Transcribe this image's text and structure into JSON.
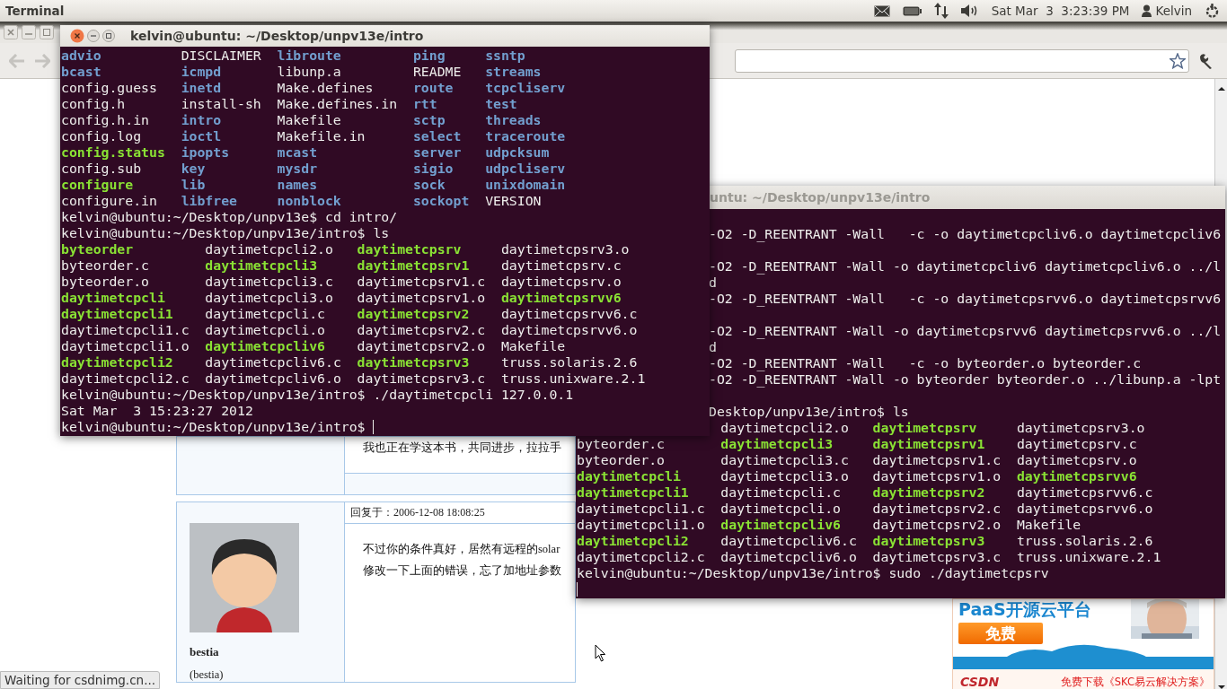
{
  "top_panel": {
    "app_name": "Terminal",
    "clock": "Sat Mar  3  3:23:39 PM",
    "user": "Kelvin"
  },
  "browser": {
    "status": "Waiting for csdnimg.cn...",
    "posts": [
      {
        "body": [
          "我也正在学这本书，共同进步，拉拉手"
        ]
      },
      {
        "reply_time": "回复于：2006-12-08 18:08:25",
        "user": "bestia",
        "user_alias": "(bestia)",
        "body": [
          "不过你的条件真好，居然有远程的solar",
          "修改一下上面的错误，忘了加地址参数"
        ]
      }
    ],
    "ad": {
      "headline": "PaaS开源云平台",
      "button": "免费",
      "logo": "CSDN",
      "footer": "免费下载《SKC易云解决方案》"
    }
  },
  "terminals": [
    {
      "title": "kelvin@ubuntu: ~/Desktop/unpv13e/intro",
      "active": true,
      "lines": [
        {
          "kind": "ls",
          "cells": [
            {
              "text": "advio",
              "kind": "dir"
            },
            {
              "text": "DISCLAIMER",
              "kind": "file"
            },
            {
              "text": "libroute",
              "kind": "dir"
            },
            {
              "text": "ping",
              "kind": "dir"
            },
            {
              "text": "ssntp",
              "kind": "dir"
            }
          ]
        },
        {
          "kind": "ls",
          "cells": [
            {
              "text": "bcast",
              "kind": "dir"
            },
            {
              "text": "icmpd",
              "kind": "dir"
            },
            {
              "text": "libunp.a",
              "kind": "file"
            },
            {
              "text": "README",
              "kind": "file"
            },
            {
              "text": "streams",
              "kind": "dir"
            }
          ]
        },
        {
          "kind": "ls",
          "cells": [
            {
              "text": "config.guess",
              "kind": "file"
            },
            {
              "text": "inetd",
              "kind": "dir"
            },
            {
              "text": "Make.defines",
              "kind": "file"
            },
            {
              "text": "route",
              "kind": "dir"
            },
            {
              "text": "tcpcliserv",
              "kind": "dir"
            }
          ]
        },
        {
          "kind": "ls",
          "cells": [
            {
              "text": "config.h",
              "kind": "file"
            },
            {
              "text": "install-sh",
              "kind": "file"
            },
            {
              "text": "Make.defines.in",
              "kind": "file"
            },
            {
              "text": "rtt",
              "kind": "dir"
            },
            {
              "text": "test",
              "kind": "dir"
            }
          ]
        },
        {
          "kind": "ls",
          "cells": [
            {
              "text": "config.h.in",
              "kind": "file"
            },
            {
              "text": "intro",
              "kind": "dir"
            },
            {
              "text": "Makefile",
              "kind": "file"
            },
            {
              "text": "sctp",
              "kind": "dir"
            },
            {
              "text": "threads",
              "kind": "dir"
            }
          ]
        },
        {
          "kind": "ls",
          "cells": [
            {
              "text": "config.log",
              "kind": "file"
            },
            {
              "text": "ioctl",
              "kind": "dir"
            },
            {
              "text": "Makefile.in",
              "kind": "file"
            },
            {
              "text": "select",
              "kind": "dir"
            },
            {
              "text": "traceroute",
              "kind": "dir"
            }
          ]
        },
        {
          "kind": "ls",
          "cells": [
            {
              "text": "config.status",
              "kind": "exec"
            },
            {
              "text": "ipopts",
              "kind": "dir"
            },
            {
              "text": "mcast",
              "kind": "dir"
            },
            {
              "text": "server",
              "kind": "dir"
            },
            {
              "text": "udpcksum",
              "kind": "dir"
            }
          ]
        },
        {
          "kind": "ls",
          "cells": [
            {
              "text": "config.sub",
              "kind": "file"
            },
            {
              "text": "key",
              "kind": "dir"
            },
            {
              "text": "mysdr",
              "kind": "dir"
            },
            {
              "text": "sigio",
              "kind": "dir"
            },
            {
              "text": "udpcliserv",
              "kind": "dir"
            }
          ]
        },
        {
          "kind": "ls",
          "cells": [
            {
              "text": "configure",
              "kind": "exec"
            },
            {
              "text": "lib",
              "kind": "dir"
            },
            {
              "text": "names",
              "kind": "dir"
            },
            {
              "text": "sock",
              "kind": "dir"
            },
            {
              "text": "unixdomain",
              "kind": "dir"
            }
          ]
        },
        {
          "kind": "ls",
          "cells": [
            {
              "text": "configure.in",
              "kind": "file"
            },
            {
              "text": "libfree",
              "kind": "dir"
            },
            {
              "text": "nonblock",
              "kind": "dir"
            },
            {
              "text": "sockopt",
              "kind": "dir"
            },
            {
              "text": "VERSION",
              "kind": "file"
            }
          ]
        },
        {
          "kind": "text",
          "text": "kelvin@ubuntu:~/Desktop/unpv13e$ cd intro/"
        },
        {
          "kind": "text",
          "text": "kelvin@ubuntu:~/Desktop/unpv13e/intro$ ls"
        },
        {
          "kind": "ls",
          "cells": [
            {
              "text": "byteorder",
              "kind": "exec"
            },
            {
              "text": "daytimetcpcli2.o",
              "kind": "file"
            },
            {
              "text": "daytimetcpsrv",
              "kind": "exec"
            },
            {
              "text": "daytimetcpsrv3.o",
              "kind": "file"
            }
          ]
        },
        {
          "kind": "ls",
          "cells": [
            {
              "text": "byteorder.c",
              "kind": "file"
            },
            {
              "text": "daytimetcpcli3",
              "kind": "exec"
            },
            {
              "text": "daytimetcpsrv1",
              "kind": "exec"
            },
            {
              "text": "daytimetcpsrv.c",
              "kind": "file"
            }
          ]
        },
        {
          "kind": "ls",
          "cells": [
            {
              "text": "byteorder.o",
              "kind": "file"
            },
            {
              "text": "daytimetcpcli3.c",
              "kind": "file"
            },
            {
              "text": "daytimetcpsrv1.c",
              "kind": "file"
            },
            {
              "text": "daytimetcpsrv.o",
              "kind": "file"
            }
          ]
        },
        {
          "kind": "ls",
          "cells": [
            {
              "text": "daytimetcpcli",
              "kind": "exec"
            },
            {
              "text": "daytimetcpcli3.o",
              "kind": "file"
            },
            {
              "text": "daytimetcpsrv1.o",
              "kind": "file"
            },
            {
              "text": "daytimetcpsrvv6",
              "kind": "exec"
            }
          ]
        },
        {
          "kind": "ls",
          "cells": [
            {
              "text": "daytimetcpcli1",
              "kind": "exec"
            },
            {
              "text": "daytimetcpcli.c",
              "kind": "file"
            },
            {
              "text": "daytimetcpsrv2",
              "kind": "exec"
            },
            {
              "text": "daytimetcpsrvv6.c",
              "kind": "file"
            }
          ]
        },
        {
          "kind": "ls",
          "cells": [
            {
              "text": "daytimetcpcli1.c",
              "kind": "file"
            },
            {
              "text": "daytimetcpcli.o",
              "kind": "file"
            },
            {
              "text": "daytimetcpsrv2.c",
              "kind": "file"
            },
            {
              "text": "daytimetcpsrvv6.o",
              "kind": "file"
            }
          ]
        },
        {
          "kind": "ls",
          "cells": [
            {
              "text": "daytimetcpcli1.o",
              "kind": "file"
            },
            {
              "text": "daytimetcpcliv6",
              "kind": "exec"
            },
            {
              "text": "daytimetcpsrv2.o",
              "kind": "file"
            },
            {
              "text": "Makefile",
              "kind": "file"
            }
          ]
        },
        {
          "kind": "ls",
          "cells": [
            {
              "text": "daytimetcpcli2",
              "kind": "exec"
            },
            {
              "text": "daytimetcpcliv6.c",
              "kind": "file"
            },
            {
              "text": "daytimetcpsrv3",
              "kind": "exec"
            },
            {
              "text": "truss.solaris.2.6",
              "kind": "file"
            }
          ]
        },
        {
          "kind": "ls",
          "cells": [
            {
              "text": "daytimetcpcli2.c",
              "kind": "file"
            },
            {
              "text": "daytimetcpcliv6.o",
              "kind": "file"
            },
            {
              "text": "daytimetcpsrv3.c",
              "kind": "file"
            },
            {
              "text": "truss.unixware.2.1",
              "kind": "file"
            }
          ]
        },
        {
          "kind": "text",
          "text": "kelvin@ubuntu:~/Desktop/unpv13e/intro$ ./daytimetcpcli 127.0.0.1"
        },
        {
          "kind": "text",
          "text": "Sat Mar  3 15:23:27 2012"
        },
        {
          "kind": "prompt",
          "text": "kelvin@ubuntu:~/Desktop/unpv13e/intro$"
        }
      ]
    },
    {
      "title": "untu: ~/Desktop/unpv13e/intro",
      "active": false,
      "upper_lines": [
        {
          "kind": "gap"
        },
        {
          "kind": "text",
          "text": "-O2 -D_REENTRANT -Wall   -c -o daytimetcpcliv6.o daytimetcpcliv6"
        },
        {
          "kind": "gap"
        },
        {
          "kind": "text",
          "text": "-O2 -D_REENTRANT -Wall -o daytimetcpcliv6 daytimetcpcliv6.o ../l"
        },
        {
          "kind": "text",
          "text": "d"
        },
        {
          "kind": "text",
          "text": "-O2 -D_REENTRANT -Wall   -c -o daytimetcpsrvv6.o daytimetcpsrvv6"
        },
        {
          "kind": "gap"
        },
        {
          "kind": "text",
          "text": "-O2 -D_REENTRANT -Wall -o daytimetcpsrvv6 daytimetcpsrvv6.o ../l"
        },
        {
          "kind": "text",
          "text": "d"
        },
        {
          "kind": "text",
          "text": "-O2 -D_REENTRANT -Wall   -c -o byteorder.o byteorder.c"
        },
        {
          "kind": "text",
          "text": "-O2 -D_REENTRANT -Wall -o byteorder byteorder.o ../libunp.a -lpt"
        },
        {
          "kind": "gap"
        },
        {
          "kind": "text",
          "text": "Desktop/unpv13e/intro$ ls"
        }
      ],
      "lines": [
        {
          "kind": "ls",
          "cells": [
            {
              "text": "daytimetcpcli2.o",
              "kind": "file"
            },
            {
              "text": "daytimetcpsrv",
              "kind": "exec"
            },
            {
              "text": "daytimetcpsrv3.o",
              "kind": "file"
            }
          ]
        },
        {
          "kind": "ls",
          "cells": [
            {
              "text": "byteorder.c",
              "kind": "file"
            },
            {
              "text": "daytimetcpcli3",
              "kind": "exec"
            },
            {
              "text": "daytimetcpsrv1",
              "kind": "exec"
            },
            {
              "text": "daytimetcpsrv.c",
              "kind": "file"
            }
          ]
        },
        {
          "kind": "ls",
          "cells": [
            {
              "text": "byteorder.o",
              "kind": "file"
            },
            {
              "text": "daytimetcpcli3.c",
              "kind": "file"
            },
            {
              "text": "daytimetcpsrv1.c",
              "kind": "file"
            },
            {
              "text": "daytimetcpsrv.o",
              "kind": "file"
            }
          ]
        },
        {
          "kind": "ls",
          "cells": [
            {
              "text": "daytimetcpcli",
              "kind": "exec"
            },
            {
              "text": "daytimetcpcli3.o",
              "kind": "file"
            },
            {
              "text": "daytimetcpsrv1.o",
              "kind": "file"
            },
            {
              "text": "daytimetcpsrvv6",
              "kind": "exec"
            }
          ]
        },
        {
          "kind": "ls",
          "cells": [
            {
              "text": "daytimetcpcli1",
              "kind": "exec"
            },
            {
              "text": "daytimetcpcli.c",
              "kind": "file"
            },
            {
              "text": "daytimetcpsrv2",
              "kind": "exec"
            },
            {
              "text": "daytimetcpsrvv6.c",
              "kind": "file"
            }
          ]
        },
        {
          "kind": "ls",
          "cells": [
            {
              "text": "daytimetcpcli1.c",
              "kind": "file"
            },
            {
              "text": "daytimetcpcli.o",
              "kind": "file"
            },
            {
              "text": "daytimetcpsrv2.c",
              "kind": "file"
            },
            {
              "text": "daytimetcpsrvv6.o",
              "kind": "file"
            }
          ]
        },
        {
          "kind": "ls",
          "cells": [
            {
              "text": "daytimetcpcli1.o",
              "kind": "file"
            },
            {
              "text": "daytimetcpcliv6",
              "kind": "exec"
            },
            {
              "text": "daytimetcpsrv2.o",
              "kind": "file"
            },
            {
              "text": "Makefile",
              "kind": "file"
            }
          ]
        },
        {
          "kind": "ls",
          "cells": [
            {
              "text": "daytimetcpcli2",
              "kind": "exec"
            },
            {
              "text": "daytimetcpcliv6.c",
              "kind": "file"
            },
            {
              "text": "daytimetcpsrv3",
              "kind": "exec"
            },
            {
              "text": "truss.solaris.2.6",
              "kind": "file"
            }
          ]
        },
        {
          "kind": "ls",
          "cells": [
            {
              "text": "daytimetcpcli2.c",
              "kind": "file"
            },
            {
              "text": "daytimetcpcliv6.o",
              "kind": "file"
            },
            {
              "text": "daytimetcpsrv3.c",
              "kind": "file"
            },
            {
              "text": "truss.unixware.2.1",
              "kind": "file"
            }
          ]
        },
        {
          "kind": "text",
          "text": "kelvin@ubuntu:~/Desktop/unpv13e/intro$ sudo ./daytimetcpsrv"
        },
        {
          "kind": "cursor"
        }
      ]
    }
  ]
}
